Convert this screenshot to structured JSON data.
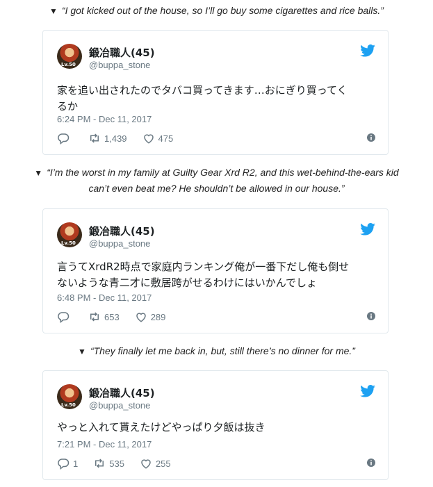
{
  "captions": [
    "“I got kicked out of the house, so I’ll go buy some cigarettes and rice balls.”",
    "“I’m the worst in my family at Guilty Gear Xrd R2, and this wet-behind-the-ears kid",
    "can’t even beat me? He shouldn’t be allowed in our house.”",
    "“They finally let me back in, but, still there’s no dinner for me.”"
  ],
  "caption_marker": "▼",
  "tweets": [
    {
      "name": "鍛冶職人(45)",
      "handle": "@buppa_stone",
      "avatar_level": "Lv.50",
      "text_lines": [
        "家を追い出されたのでタバコ買ってきます…おにぎり買ってく",
        "るか"
      ],
      "date": "6:24 PM - Dec 11, 2017",
      "replies": "",
      "retweets": "1,439",
      "likes": "475"
    },
    {
      "name": "鍛冶職人(45)",
      "handle": "@buppa_stone",
      "avatar_level": "Lv.50",
      "text_lines": [
        "言うてXrdR2時点で家庭内ランキング俺が一番下だし俺も倒せ",
        "ないような青二才に敷居跨がせるわけにはいかんでしょ"
      ],
      "date": "6:48 PM - Dec 11, 2017",
      "replies": "",
      "retweets": "653",
      "likes": "289"
    },
    {
      "name": "鍛冶職人(45)",
      "handle": "@buppa_stone",
      "avatar_level": "Lv.50",
      "text_lines": [
        "やっと入れて貰えたけどやっぱり夕飯は抜き"
      ],
      "date": "7:21 PM - Dec 11, 2017",
      "replies": "1",
      "retweets": "535",
      "likes": "255"
    }
  ],
  "icons": {
    "twitter_color": "#1da1f2",
    "action_color": "#697882"
  }
}
